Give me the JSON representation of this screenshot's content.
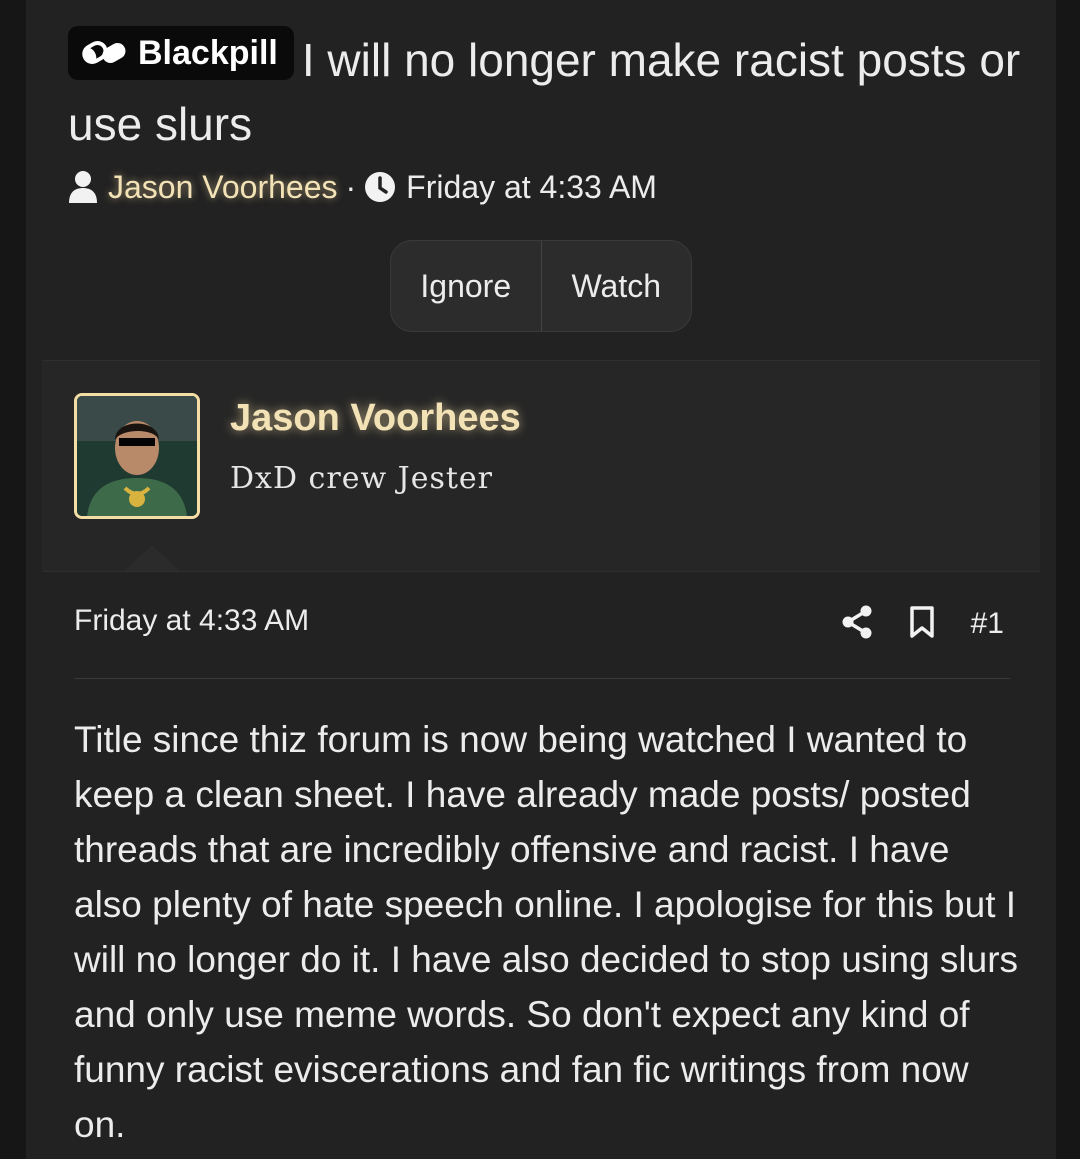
{
  "thread": {
    "prefix": "Blackpill",
    "title": "I will no longer make racist posts or use slurs",
    "author": "Jason Voorhees",
    "separator": "·",
    "date": "Friday at 4:33 AM"
  },
  "actions": {
    "ignore": "Ignore",
    "watch": "Watch"
  },
  "post": {
    "username": "Jason Voorhees",
    "user_title": "DxD crew Jester",
    "date": "Friday at 4:33 AM",
    "number": "#1",
    "body": "Title since thiz forum is now being watched I wanted to keep a clean sheet. I have already made posts/ posted threads that are incredibly offensive and racist. I have also plenty of hate speech online. I apologise for this but I will no longer do it. I have also decided to stop using slurs and only use meme words. So don't expect any kind of funny racist eviscerations and fan fic writings from now on."
  },
  "icons": {
    "prefix": "pill-icon",
    "author": "user-icon",
    "date": "clock-icon",
    "share": "share-icon",
    "bookmark": "bookmark-icon"
  },
  "colors": {
    "background": "#222222",
    "accent_name": "#f3e2b6",
    "prefix_bg": "#0a0a0a",
    "avatar_border": "#f3dfa6"
  }
}
